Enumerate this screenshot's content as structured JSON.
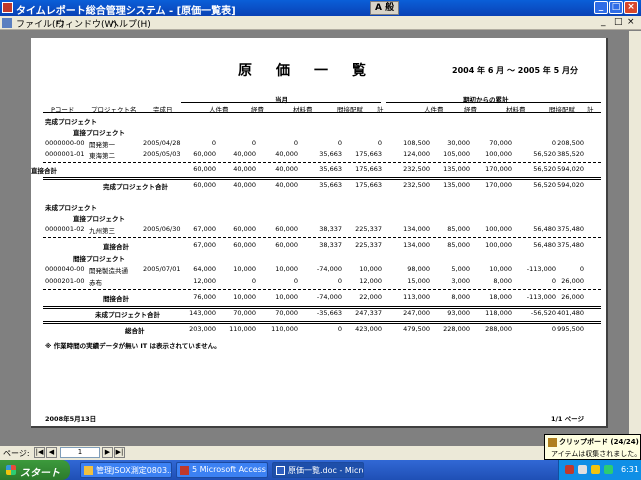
{
  "window": {
    "title": "タイムレポート総合管理システム - [原価一覧表]",
    "ime": "A 般"
  },
  "menu": {
    "items": [
      "ファイル(F)",
      "ウィンドウ(W)",
      "ヘルプ(H)"
    ],
    "ctrls": [
      "_",
      "□",
      "×"
    ]
  },
  "report": {
    "title": "原価一覧",
    "period": "2004 年 6 月 ～ 2005 年 5 月分",
    "group_current": "当月",
    "group_cumulative": "期初からの累計",
    "headers": [
      "Pコード",
      "プロジェクト名",
      "完成日",
      "人件費",
      "経費",
      "材料費",
      "間接配賦",
      "計",
      "人件費",
      "経費",
      "材料費",
      "間接配賦",
      "計"
    ],
    "sections": [
      {
        "label": "完成プロジェクト",
        "sub": "直接プロジェクト"
      },
      {
        "label": "未成プロジェクト",
        "sub": "直接プロジェクト"
      },
      {
        "label": "",
        "sub": "間接プロジェクト"
      }
    ],
    "rows": [
      {
        "code": "0000000-00",
        "name": "開発第一",
        "date": "2005/04/28",
        "vals": [
          "0",
          "0",
          "0",
          "0",
          "0",
          "108,500",
          "30,000",
          "70,000",
          "0",
          "208,500"
        ]
      },
      {
        "code": "0000001-01",
        "name": "東海第二",
        "date": "2005/05/03",
        "vals": [
          "60,000",
          "40,000",
          "40,000",
          "35,663",
          "175,663",
          "124,000",
          "105,000",
          "100,000",
          "56,520",
          "385,520"
        ]
      },
      {
        "code": "",
        "name": "直接合計",
        "date": "",
        "vals": [
          "60,000",
          "40,000",
          "40,000",
          "35,663",
          "175,663",
          "232,500",
          "135,000",
          "170,000",
          "56,520",
          "594,020"
        ]
      },
      {
        "code": "",
        "name": "完成プロジェクト合計",
        "date": "",
        "vals": [
          "60,000",
          "40,000",
          "40,000",
          "35,663",
          "175,663",
          "232,500",
          "135,000",
          "170,000",
          "56,520",
          "594,020"
        ]
      },
      {
        "code": "0000001-02",
        "name": "九州第三",
        "date": "2005/06/30",
        "vals": [
          "67,000",
          "60,000",
          "60,000",
          "38,337",
          "225,337",
          "134,000",
          "85,000",
          "100,000",
          "56,480",
          "375,480"
        ]
      },
      {
        "code": "",
        "name": "直接合計",
        "date": "",
        "vals": [
          "67,000",
          "60,000",
          "60,000",
          "38,337",
          "225,337",
          "134,000",
          "85,000",
          "100,000",
          "56,480",
          "375,480"
        ]
      },
      {
        "code": "0000040-00",
        "name": "開発製造共通",
        "date": "2005/07/01",
        "vals": [
          "64,000",
          "10,000",
          "10,000",
          "-74,000",
          "10,000",
          "98,000",
          "5,000",
          "10,000",
          "-113,000",
          "0"
        ]
      },
      {
        "code": "0000201-00",
        "name": "赤布",
        "date": "",
        "vals": [
          "12,000",
          "0",
          "0",
          "0",
          "12,000",
          "15,000",
          "3,000",
          "8,000",
          "0",
          "26,000"
        ]
      },
      {
        "code": "",
        "name": "間接合計",
        "date": "",
        "vals": [
          "76,000",
          "10,000",
          "10,000",
          "-74,000",
          "22,000",
          "113,000",
          "8,000",
          "18,000",
          "-113,000",
          "26,000"
        ]
      },
      {
        "code": "",
        "name": "未成プロジェクト合計",
        "date": "",
        "vals": [
          "143,000",
          "70,000",
          "70,000",
          "-35,663",
          "247,337",
          "247,000",
          "93,000",
          "118,000",
          "-56,520",
          "401,480"
        ]
      },
      {
        "code": "",
        "name": "総合計",
        "date": "",
        "vals": [
          "203,000",
          "110,000",
          "110,000",
          "0",
          "423,000",
          "479,500",
          "228,000",
          "288,000",
          "0",
          "995,500"
        ]
      }
    ],
    "note": "※ 作業時間の実績データが無い IT は表示されていません。",
    "footer_date": "2008年5月13日",
    "footer_page": "1/1 ページ"
  },
  "status": {
    "page_label": "ページ:",
    "page_value": "1",
    "nav": [
      "|◀",
      "◀",
      "▶",
      "▶|"
    ]
  },
  "clipboard": {
    "title": "クリップボード (24/24)",
    "message": "アイテムは収集されました。"
  },
  "taskbar": {
    "start": "スタート",
    "tasks": [
      "管理JSOX測定0803...",
      "5 Microsoft Access ...",
      "原価一覧.doc - Micro..."
    ],
    "clock": "6:31"
  }
}
